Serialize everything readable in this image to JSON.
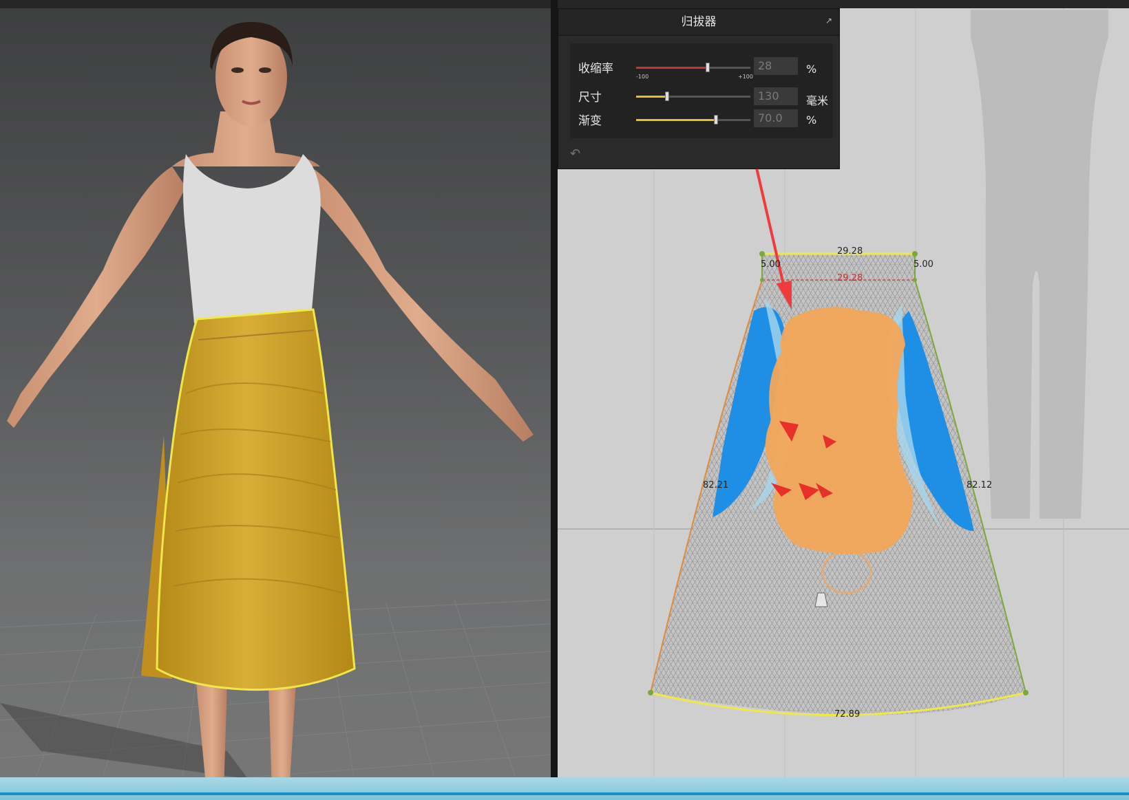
{
  "panel": {
    "title": "归拔器",
    "rows": [
      {
        "label": "收缩率",
        "value": "28",
        "unit": "%",
        "slider_pos": 0.64,
        "color": "#c8352e",
        "min_label": "-100",
        "max_label": "+100"
      },
      {
        "label": "尺寸",
        "value": "130",
        "unit": "毫米",
        "slider_pos": 0.27,
        "color": "#e6c02a"
      },
      {
        "label": "渐变",
        "value": "70.0",
        "unit": "%",
        "slider_pos": 0.7,
        "color": "#e6c02a"
      }
    ]
  },
  "pattern": {
    "top_length": "29.28",
    "top_inner_length": "29.28",
    "left_seam_allowance": "5.00",
    "right_seam_allowance": "5.00",
    "left_side": "82.21",
    "right_side": "82.12",
    "hem_length": "72.89"
  },
  "colors": {
    "skirt": "#d4a72c",
    "heat_orange": "#f2a65a",
    "heat_blue": "#1f8fe6",
    "outline_yellow": "#f0e84a",
    "annotation_arrow": "#ef3b3b"
  }
}
